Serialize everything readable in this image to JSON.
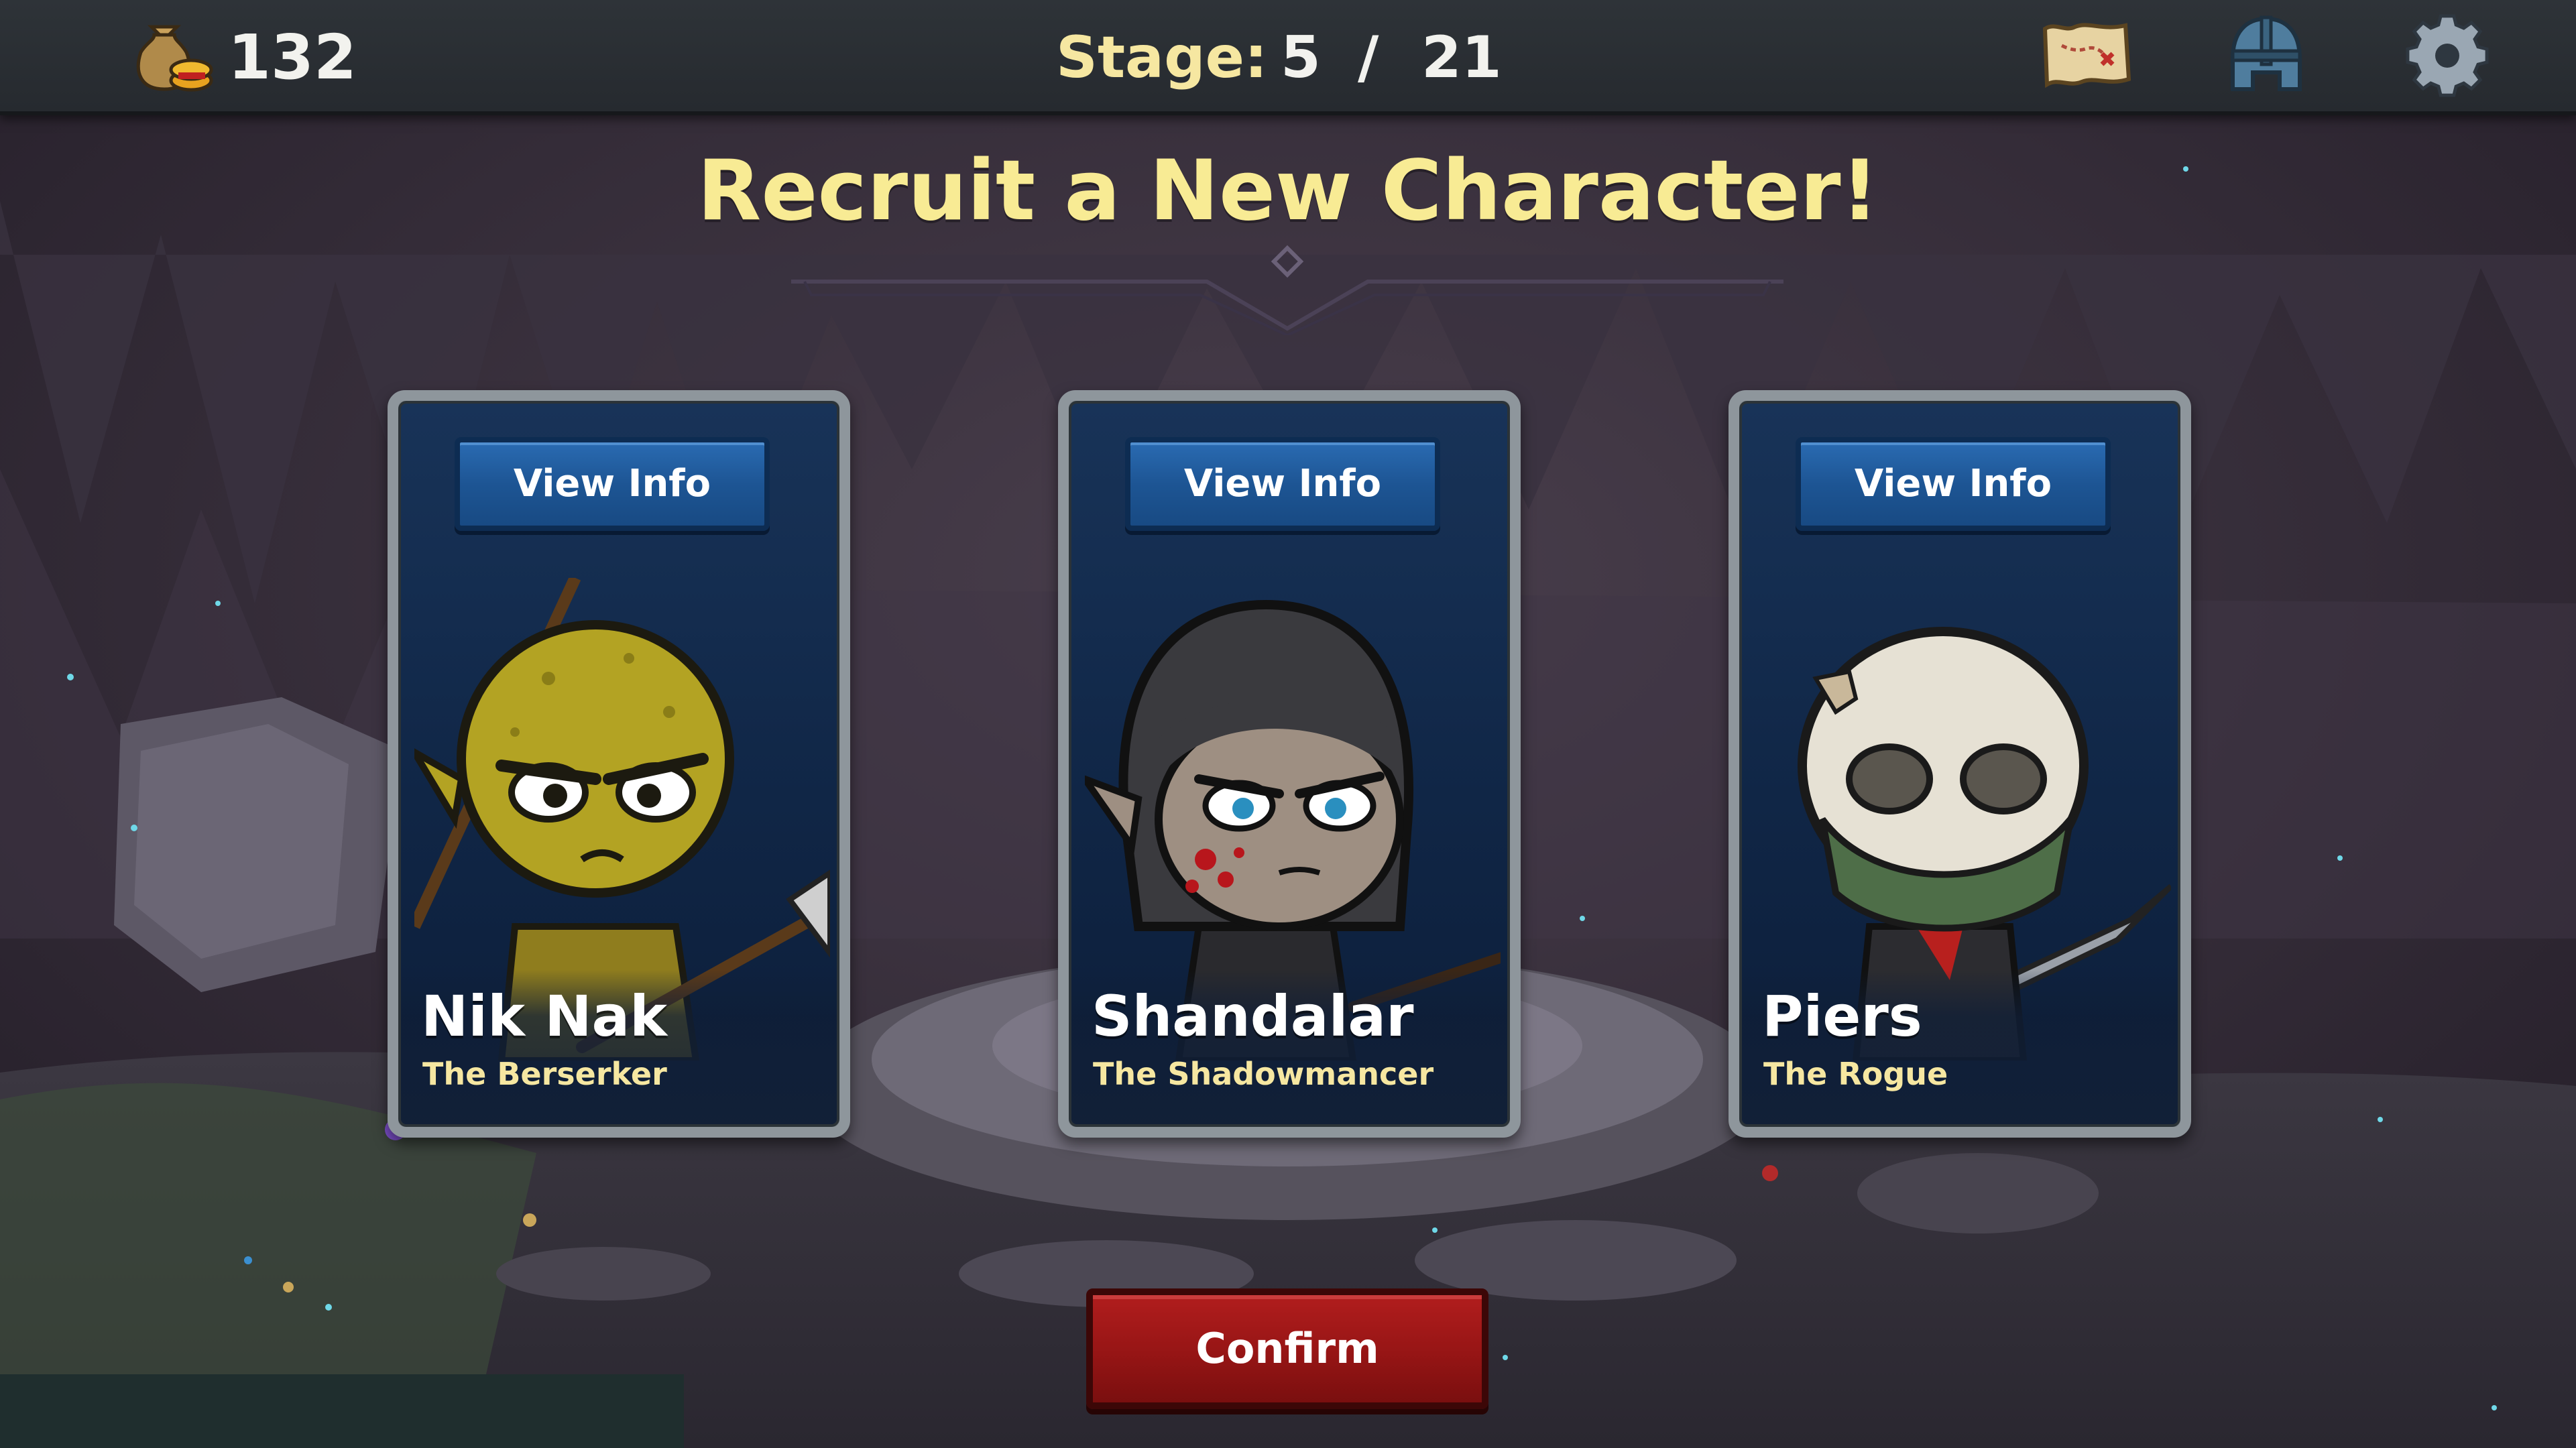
{
  "topbar": {
    "gold_amount": "132",
    "stage_label": "Stage:",
    "stage_current": "5",
    "stage_separator": "/",
    "stage_total": "21"
  },
  "title": "Recruit a New Character!",
  "cards": [
    {
      "view_label": "View Info",
      "name": "Nik Nak",
      "class": "The Berserker"
    },
    {
      "view_label": "View Info",
      "name": "Shandalar",
      "class": "The Shadowmancer"
    },
    {
      "view_label": "View Info",
      "name": "Piers",
      "class": "The Rogue"
    }
  ],
  "confirm_label": "Confirm",
  "icons": {
    "gold": "gold-sack-icon",
    "map": "treasure-map-icon",
    "helmet": "knight-helmet-icon",
    "settings": "gear-icon"
  },
  "colors": {
    "title": "#f8eb94",
    "view_button": "#1d5594",
    "confirm_button": "#961515",
    "card_bg": "#102646"
  }
}
